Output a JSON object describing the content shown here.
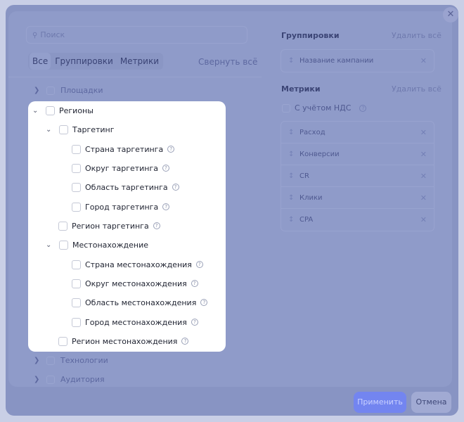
{
  "search": {
    "placeholder": "Поиск",
    "icon": "search-icon"
  },
  "tabs": [
    {
      "label": "Все",
      "active": true
    },
    {
      "label": "Группировки",
      "active": false
    },
    {
      "label": "Метрики",
      "active": false
    }
  ],
  "collapse_all_label": "Свернуть всё",
  "background_tree": {
    "top": [
      {
        "label": "Площадки"
      }
    ],
    "bottom": [
      {
        "label": "Технологии"
      },
      {
        "label": "Аудитория"
      }
    ]
  },
  "tree": {
    "regions": {
      "label": "Регионы",
      "targeting": {
        "label": "Таргетинг",
        "children": [
          "Страна таргетинга",
          "Округ таргетинга",
          "Область таргетинга",
          "Город таргетинга"
        ]
      },
      "targeting_region": "Регион таргетинга",
      "location": {
        "label": "Местонахождение",
        "children": [
          "Страна местонахождения",
          "Округ местонахождения",
          "Область местонахождения",
          "Город местонахождения"
        ]
      },
      "location_region": "Регион местонахождения"
    }
  },
  "groupings": {
    "title": "Группировки",
    "remove_all": "Удалить всё",
    "items": [
      "Название кампании"
    ]
  },
  "metrics": {
    "title": "Метрики",
    "remove_all": "Удалить всё",
    "vat_label": "С учётом НДС",
    "items": [
      "Расход",
      "Конверсии",
      "CR",
      "Клики",
      "CPA"
    ]
  },
  "footer": {
    "apply": "Применить",
    "cancel": "Отмена"
  },
  "colors": {
    "accent": "#7385f0",
    "overlay": "#8f9bc9",
    "panel": "#ffffff"
  }
}
